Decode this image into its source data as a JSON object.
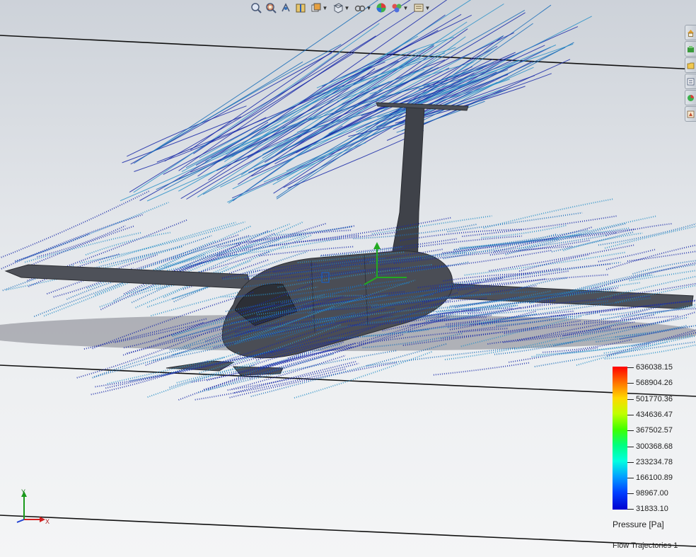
{
  "hud_toolbar": {
    "items": [
      {
        "icon": "zoom-to-fit-icon",
        "dropdown": false
      },
      {
        "icon": "zoom-to-area-icon",
        "dropdown": false
      },
      {
        "icon": "previous-view-icon",
        "dropdown": false
      },
      {
        "icon": "section-view-icon",
        "dropdown": false
      },
      {
        "icon": "view-orientation-icon",
        "dropdown": true
      },
      {
        "icon": "display-style-icon",
        "dropdown": true
      },
      {
        "icon": "hide-show-items-icon",
        "dropdown": true
      },
      {
        "icon": "edit-appearance-icon",
        "dropdown": false
      },
      {
        "icon": "apply-scene-icon",
        "dropdown": true
      },
      {
        "icon": "view-settings-icon",
        "dropdown": true
      }
    ]
  },
  "task_pane": {
    "tabs": [
      "home-icon",
      "design-library-icon",
      "file-explorer-icon",
      "view-palette-icon",
      "appearances-icon",
      "custom-properties-icon"
    ]
  },
  "legend": {
    "title": "Pressure [Pa]",
    "values": [
      "636038.15",
      "568904.26",
      "501770.36",
      "434636.47",
      "367502.57",
      "300368.68",
      "233234.78",
      "166100.89",
      "98967.00",
      "31833.10"
    ],
    "colors": [
      "#ff0000",
      "#ff7a00",
      "#ffe000",
      "#b8ff00",
      "#40ff00",
      "#00ff90",
      "#00ffee",
      "#0090ff",
      "#0040ff",
      "#0000cc"
    ]
  },
  "plot_name": "Flow Trajectories 1",
  "triad": {
    "y_label": "Y",
    "x_label": "X"
  },
  "colors": {
    "airframe": "#4a4d55",
    "streamline_dark": "#1a2aa8",
    "streamline_mid": "#1c6fb8",
    "streamline_light": "#2a90c8"
  }
}
